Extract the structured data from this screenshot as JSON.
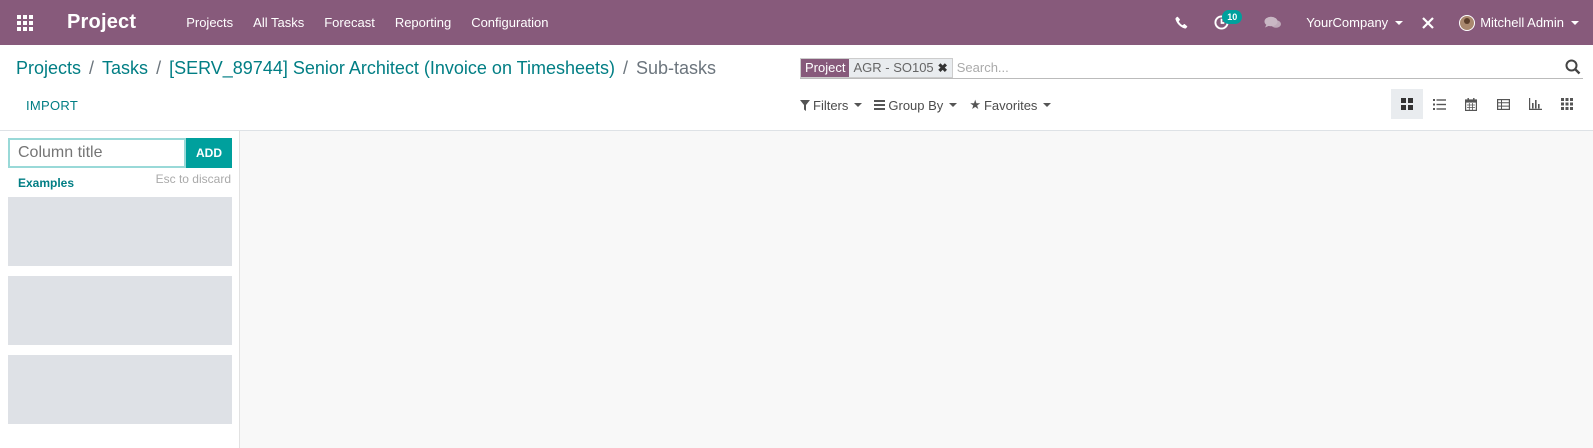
{
  "navbar": {
    "app_name": "Project",
    "menu": [
      "Projects",
      "All Tasks",
      "Forecast",
      "Reporting",
      "Configuration"
    ],
    "activity_count": "10",
    "company": "YourCompany",
    "user": "Mitchell Admin",
    "bg_color": "#875a7b"
  },
  "breadcrumb": {
    "items": [
      "Projects",
      "Tasks",
      "[SERV_89744] Senior Architect (Invoice on Timesheets)"
    ],
    "current": "Sub-tasks",
    "separator": "/"
  },
  "search": {
    "facet_category": "Project",
    "facet_value": "AGR - SO105",
    "placeholder": "Search..."
  },
  "actions": {
    "import_label": "IMPORT",
    "filters_label": "Filters",
    "groupby_label": "Group By",
    "favorites_label": "Favorites"
  },
  "views": [
    "kanban-icon",
    "list-icon",
    "calendar-icon",
    "pivot-icon",
    "graph-icon",
    "grid-icon"
  ],
  "quick_create": {
    "input_placeholder": "Column title",
    "add_label": "ADD",
    "examples_label": "Examples",
    "discard_hint": "Esc to discard"
  }
}
